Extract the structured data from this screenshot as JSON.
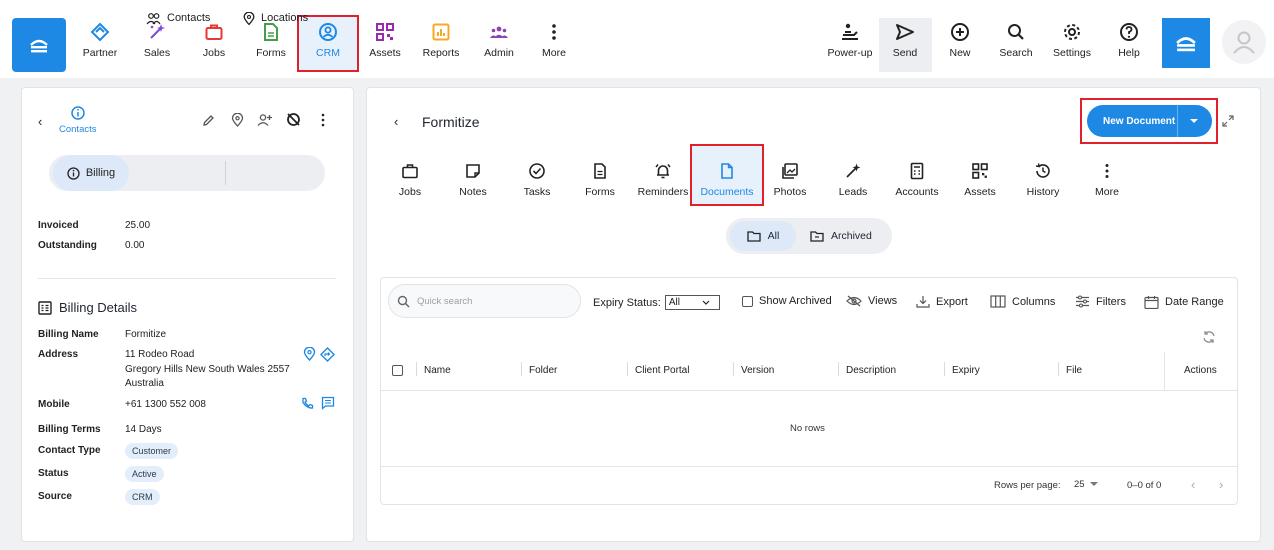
{
  "nav": {
    "items": [
      {
        "label": "Partner",
        "icon": "handshake-icon"
      },
      {
        "label": "Sales",
        "icon": "sparkle-icon"
      },
      {
        "label": "Jobs",
        "icon": "briefcase-icon"
      },
      {
        "label": "Forms",
        "icon": "form-icon"
      },
      {
        "label": "CRM",
        "icon": "contact-icon"
      },
      {
        "label": "Assets",
        "icon": "qr-icon"
      },
      {
        "label": "Reports",
        "icon": "report-icon"
      },
      {
        "label": "Admin",
        "icon": "team-icon"
      },
      {
        "label": "More",
        "icon": "more-icon"
      }
    ],
    "right_items": [
      {
        "label": "Power-up",
        "icon": "power-up-icon"
      },
      {
        "label": "Send",
        "icon": "send-icon"
      },
      {
        "label": "New",
        "icon": "plus-circle-icon"
      },
      {
        "label": "Search",
        "icon": "search-icon"
      },
      {
        "label": "Settings",
        "icon": "gear-icon"
      },
      {
        "label": "Help",
        "icon": "help-icon"
      }
    ]
  },
  "left": {
    "header_label": "Contacts",
    "segments": [
      "Billing",
      "Contacts",
      "Locations"
    ],
    "invoiced_label": "Invoiced",
    "invoiced_value": "25.00",
    "outstanding_label": "Outstanding",
    "outstanding_value": "0.00",
    "billing_title": "Billing Details",
    "billing_name_label": "Billing Name",
    "billing_name_value": "Formitize",
    "address_label": "Address",
    "address_line1": "11 Rodeo Road",
    "address_line2": "Gregory Hills New South Wales 2557",
    "address_line3": "Australia",
    "mobile_label": "Mobile",
    "mobile_value": "+61 1300 552 008",
    "terms_label": "Billing Terms",
    "terms_value": "14 Days",
    "contact_type_label": "Contact Type",
    "contact_type_value": "Customer",
    "status_label": "Status",
    "status_value": "Active",
    "source_label": "Source",
    "source_value": "CRM"
  },
  "right": {
    "title": "Formitize",
    "new_document_label": "New Document",
    "tabs": [
      "Jobs",
      "Notes",
      "Tasks",
      "Forms",
      "Reminders",
      "Documents",
      "Photos",
      "Leads",
      "Accounts",
      "Assets",
      "History",
      "More"
    ],
    "filter_all": "All",
    "filter_archived": "Archived",
    "search_placeholder": "Quick search",
    "expiry_label": "Expiry Status:",
    "expiry_value": "All",
    "show_archived": "Show Archived",
    "views": "Views",
    "export": "Export",
    "columns": "Columns",
    "filters": "Filters",
    "date_range": "Date Range",
    "col_headers": [
      "Name",
      "Folder",
      "Client Portal",
      "Version",
      "Description",
      "Expiry",
      "File",
      "Actions"
    ],
    "empty_text": "No rows",
    "rows_per_page_label": "Rows per page:",
    "rows_per_page_value": "25",
    "range_text": "0–0 of 0"
  },
  "colors": {
    "accent": "#1e88e5",
    "highlight": "#e0202a"
  }
}
